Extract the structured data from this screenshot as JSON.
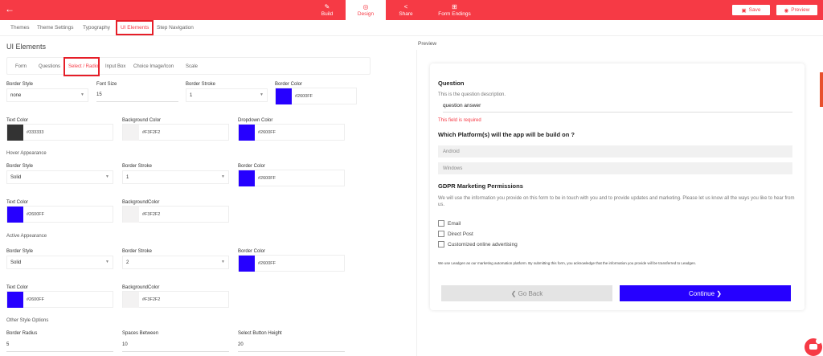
{
  "colors": {
    "accent": "#f63a45",
    "highlight": "#e61e28",
    "continue_button": "#2600ff"
  },
  "topbar": {
    "back_icon": "arrow-left-icon",
    "tabs": [
      {
        "label": "Build",
        "icon": "edit-icon"
      },
      {
        "label": "Design",
        "icon": "palette-icon"
      },
      {
        "label": "Share",
        "icon": "share-icon"
      },
      {
        "label": "Form Endings",
        "icon": "flow-icon"
      }
    ],
    "active_tab": "Design",
    "save_label": "Save",
    "preview_label": "Preview"
  },
  "subnav": {
    "items": [
      "Themes",
      "Theme Settings",
      "Typography",
      "UI Elements",
      "Step Navigation"
    ],
    "active": "UI Elements"
  },
  "main": {
    "title": "UI Elements",
    "tabs": [
      "Form",
      "Questions",
      "Select / Radio",
      "Input Box",
      "Choice Image/Icon",
      "Scale"
    ],
    "active_tab": "Select / Radio",
    "default": {
      "border_style": {
        "label": "Border Style",
        "value": "none"
      },
      "font_size": {
        "label": "Font Size",
        "value": "15"
      },
      "border_stroke": {
        "label": "Border Stroke",
        "value": "1"
      },
      "border_color": {
        "label": "Border Color",
        "value": "#2600FF"
      },
      "text_color": {
        "label": "Text Color",
        "value": "#333333"
      },
      "background_color": {
        "label": "Background Color",
        "value": "#F3F2F2"
      },
      "dropdown_color": {
        "label": "Dropdown Color",
        "value": "#2600FF"
      }
    },
    "hover": {
      "title": "Hover Appearance",
      "border_style": {
        "label": "Border Style",
        "value": "Solid"
      },
      "border_stroke": {
        "label": "Border Stroke",
        "value": "1"
      },
      "border_color": {
        "label": "Border Color",
        "value": "#2600FF"
      },
      "text_color": {
        "label": "Text Color",
        "value": "#2600FF"
      },
      "background_color": {
        "label": "BackgroundColor",
        "value": "#F3F2F2"
      }
    },
    "active": {
      "title": "Active Appearance",
      "border_style": {
        "label": "Border Style",
        "value": "Solid"
      },
      "border_stroke": {
        "label": "Border Stroke",
        "value": "2"
      },
      "border_color": {
        "label": "Border Color",
        "value": "#2600FF"
      },
      "text_color": {
        "label": "Text Color",
        "value": "#2600FF"
      },
      "background_color": {
        "label": "BackgroundColor",
        "value": "#F3F2F2"
      }
    },
    "other": {
      "title": "Other Style Options",
      "border_radius": {
        "label": "Border Radius",
        "value": "5"
      },
      "spaces_between": {
        "label": "Spaces Between",
        "value": "10"
      },
      "select_button_height": {
        "label": "Select Button Height",
        "value": "20"
      }
    }
  },
  "preview": {
    "label": "Preview",
    "question_title": "Question",
    "question_description": "This is the question description.",
    "answer_value": "question answer",
    "error_text": "This field is required",
    "platform_question": "Which Platform(s) will the app will be build on ?",
    "platform_options": [
      "Android",
      "Windows"
    ],
    "gdpr_title": "GDPR Marketing Permissions",
    "gdpr_text": "We will use the information you provide on this form to be in touch with you and to provide updates and marketing. Please let us know all the ways you like to hear from us.",
    "gdpr_options": [
      "Email",
      "Direct Post",
      "Customized online advertising"
    ],
    "footer_note": "We use Leadgen as our marketing automation platform. By submitting this form, you acknowledge that the information you provide will be transferred to Leadgen.",
    "back_label": "❮ Go Back",
    "continue_label": "Continue ❯"
  }
}
